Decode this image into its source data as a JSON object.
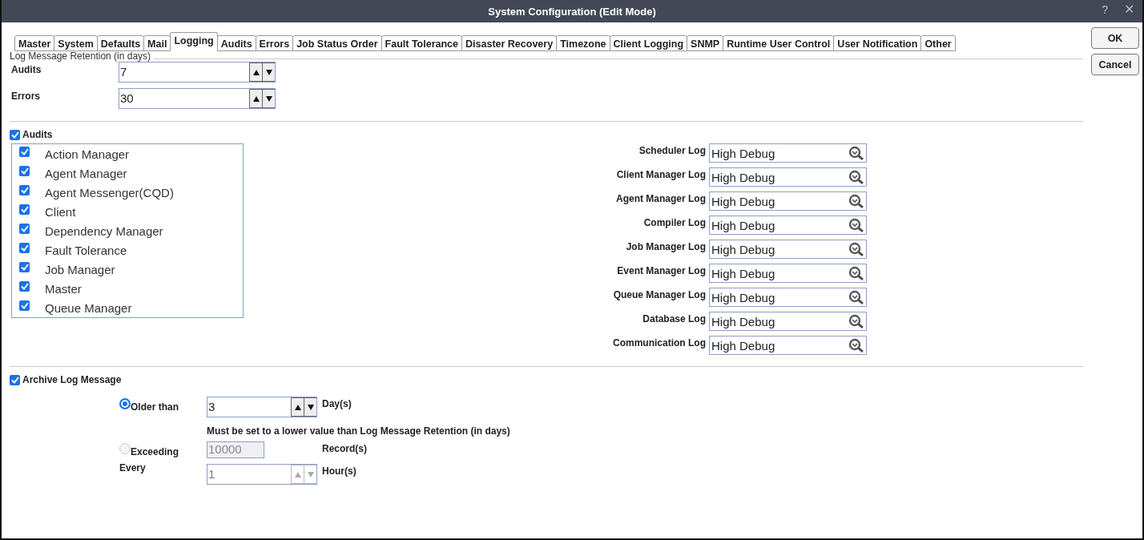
{
  "window": {
    "title": "System Configuration (Edit Mode)",
    "help": "?",
    "close": "✕"
  },
  "tabs": [
    {
      "label": "Master",
      "selected": false
    },
    {
      "label": "System",
      "selected": false
    },
    {
      "label": "Defaults",
      "selected": false
    },
    {
      "label": "Mail",
      "selected": false
    },
    {
      "label": "Logging",
      "selected": true
    },
    {
      "label": "Audits",
      "selected": false
    },
    {
      "label": "Errors",
      "selected": false
    },
    {
      "label": "Job Status Order",
      "selected": false
    },
    {
      "label": "Fault Tolerance",
      "selected": false
    },
    {
      "label": "Disaster Recovery",
      "selected": false
    },
    {
      "label": "Timezone",
      "selected": false
    },
    {
      "label": "Client Logging",
      "selected": false
    },
    {
      "label": "SNMP",
      "selected": false
    },
    {
      "label": "Runtime User Control",
      "selected": false
    },
    {
      "label": "User Notification",
      "selected": false
    },
    {
      "label": "Other",
      "selected": false
    }
  ],
  "buttons": [
    "OK",
    "Cancel"
  ],
  "retention": {
    "legend": "Log Message Retention (in days)",
    "fields": [
      {
        "label": "Audits",
        "value": "7"
      },
      {
        "label": "Errors",
        "value": "30"
      }
    ]
  },
  "audits": {
    "label": "Audits",
    "checked": true,
    "items": [
      {
        "label": "Action Manager",
        "checked": true
      },
      {
        "label": "Agent Manager",
        "checked": true
      },
      {
        "label": "Agent Messenger(CQD)",
        "checked": true
      },
      {
        "label": "Client",
        "checked": true
      },
      {
        "label": "Dependency Manager",
        "checked": true
      },
      {
        "label": "Fault Tolerance",
        "checked": true
      },
      {
        "label": "Job Manager",
        "checked": true
      },
      {
        "label": "Master",
        "checked": true
      },
      {
        "label": "Queue Manager",
        "checked": true
      }
    ]
  },
  "logs": [
    {
      "label": "Scheduler Log",
      "value": "High Debug"
    },
    {
      "label": "Client Manager Log",
      "value": "High Debug"
    },
    {
      "label": "Agent Manager Log",
      "value": "High Debug"
    },
    {
      "label": "Compiler Log",
      "value": "High Debug"
    },
    {
      "label": "Job Manager Log",
      "value": "High Debug"
    },
    {
      "label": "Event Manager Log",
      "value": "High Debug"
    },
    {
      "label": "Queue Manager Log",
      "value": "High Debug"
    },
    {
      "label": "Database Log",
      "value": "High Debug"
    },
    {
      "label": "Communication Log",
      "value": "High Debug"
    }
  ],
  "archive": {
    "label": "Archive Log Message",
    "checked": true,
    "older": {
      "label": "Older than",
      "selected": true,
      "disabled": false,
      "value": "3",
      "unit": "Day(s)"
    },
    "note": "Must be set to a lower value than Log Message Retention (in days)",
    "exceeding": {
      "label": "Exceeding",
      "selected": false,
      "disabled": true,
      "value": "10000",
      "unit": "Record(s)"
    },
    "every": {
      "label": "Every",
      "value": "1",
      "disabled": true,
      "unit": "Hour(s)"
    }
  }
}
